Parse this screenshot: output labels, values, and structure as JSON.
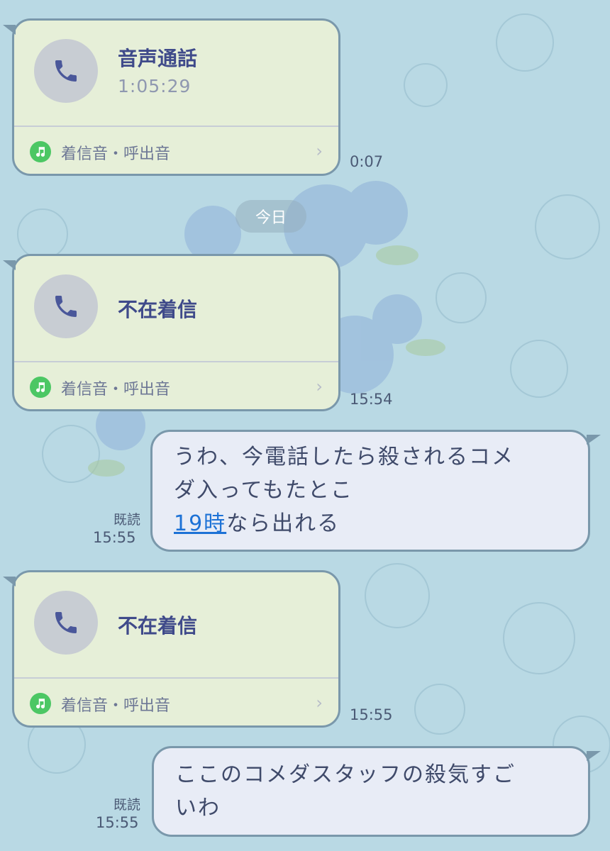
{
  "colors": {
    "background": "#b9d9e4",
    "incoming_bubble": "#e6efd8",
    "outgoing_bubble": "#e8ecf6",
    "border": "#7a98ab",
    "link": "#1d72d6",
    "music_icon": "#4cc764"
  },
  "date_separator": "今日",
  "messages": [
    {
      "type": "call",
      "title": "音声通話",
      "duration": "1:05:29",
      "ringtone_label": "着信音・呼出音",
      "time": "0:07",
      "icon": "phone-icon"
    },
    {
      "type": "call",
      "title": "不在着信",
      "ringtone_label": "着信音・呼出音",
      "time": "15:54",
      "icon": "phone-icon"
    },
    {
      "type": "text",
      "line1": "うわ、今電話したら殺されるコメ",
      "line2": "ダ入ってもたとこ",
      "link": "19時",
      "line3_rest": "なら出れる",
      "read": "既読",
      "time": "15:55"
    },
    {
      "type": "call",
      "title": "不在着信",
      "ringtone_label": "着信音・呼出音",
      "time": "15:55",
      "icon": "phone-icon"
    },
    {
      "type": "text",
      "line1": "ここのコメダスタッフの殺気すご",
      "line2": "いわ",
      "read": "既読",
      "time": "15:55"
    }
  ]
}
